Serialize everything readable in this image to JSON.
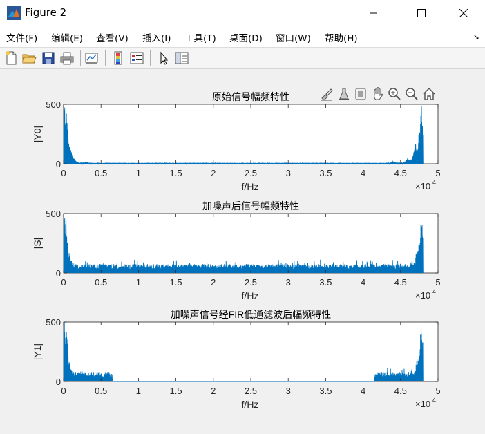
{
  "window": {
    "title": "Figure 2"
  },
  "menu": [
    {
      "label": "文件(F)"
    },
    {
      "label": "编辑(E)"
    },
    {
      "label": "查看(V)"
    },
    {
      "label": "插入(I)"
    },
    {
      "label": "工具(T)"
    },
    {
      "label": "桌面(D)"
    },
    {
      "label": "窗口(W)"
    },
    {
      "label": "帮助(H)"
    }
  ],
  "toolbar_icons": [
    "new-figure-icon",
    "open-file-icon",
    "save-icon",
    "print-icon",
    "link-plot-icon",
    "colorbar-icon",
    "legend-icon",
    "pointer-icon",
    "property-inspector-icon"
  ],
  "plot_toolbar_icons": [
    "brush-icon",
    "data-cursor-icon",
    "rotate-icon",
    "pan-icon",
    "zoom-in-icon",
    "zoom-out-icon",
    "home-icon"
  ],
  "colors": {
    "line": "#0072BD",
    "axes_bg": "#ffffff",
    "figure_bg": "#f0f0f0"
  },
  "chart_data": [
    {
      "type": "line",
      "title": "原始信号幅频特性",
      "xlabel": "f/Hz",
      "ylabel": "|Y0|",
      "xlim": [
        0,
        50000
      ],
      "ylim": [
        0,
        500
      ],
      "xticks": [
        "0",
        "0.5",
        "1",
        "1.5",
        "2",
        "2.5",
        "3",
        "3.5",
        "4",
        "4.5",
        "5"
      ],
      "yticks": [
        "0",
        "500"
      ],
      "x_exponent": "×10",
      "x_exponent_power": "4",
      "grid": false,
      "series": [
        {
          "noise_floor": 3,
          "spikes": [
            {
              "x": 100,
              "y": 500
            },
            {
              "x": 300,
              "y": 480
            },
            {
              "x": 600,
              "y": 180
            },
            {
              "x": 1000,
              "y": 60
            },
            {
              "x": 1500,
              "y": 30
            },
            {
              "x": 3000,
              "y": 18
            },
            {
              "x": 44000,
              "y": 25
            },
            {
              "x": 46000,
              "y": 50
            },
            {
              "x": 47000,
              "y": 160
            },
            {
              "x": 47800,
              "y": 500
            }
          ],
          "x_end": 48000
        }
      ]
    },
    {
      "type": "line",
      "title": "加噪声后信号幅频特性",
      "xlabel": "f/Hz",
      "ylabel": "|S|",
      "xlim": [
        0,
        50000
      ],
      "ylim": [
        0,
        500
      ],
      "xticks": [
        "0",
        "0.5",
        "1",
        "1.5",
        "2",
        "2.5",
        "3",
        "3.5",
        "4",
        "4.5",
        "5"
      ],
      "yticks": [
        "0",
        "500"
      ],
      "x_exponent": "×10",
      "x_exponent_power": "4",
      "grid": false,
      "series": [
        {
          "noise_floor": 60,
          "spikes": [
            {
              "x": 100,
              "y": 500
            },
            {
              "x": 300,
              "y": 470
            },
            {
              "x": 600,
              "y": 200
            },
            {
              "x": 1000,
              "y": 110
            },
            {
              "x": 46500,
              "y": 110
            },
            {
              "x": 47200,
              "y": 200
            },
            {
              "x": 47800,
              "y": 500
            }
          ],
          "x_end": 48000
        }
      ]
    },
    {
      "type": "line",
      "title": "加噪声信号经FIR低通滤波后幅频特性",
      "xlabel": "f/Hz",
      "ylabel": "|Y1|",
      "xlim": [
        0,
        50000
      ],
      "ylim": [
        0,
        500
      ],
      "xticks": [
        "0",
        "0.5",
        "1",
        "1.5",
        "2",
        "2.5",
        "3",
        "3.5",
        "4",
        "4.5",
        "5"
      ],
      "yticks": [
        "0",
        "500"
      ],
      "x_exponent": "×10",
      "x_exponent_power": "4",
      "grid": false,
      "series": [
        {
          "noise_floor": 60,
          "passband": [
            [
              0,
              6500
            ],
            [
              41500,
              48000
            ]
          ],
          "spikes": [
            {
              "x": 100,
              "y": 500
            },
            {
              "x": 300,
              "y": 470
            },
            {
              "x": 600,
              "y": 190
            },
            {
              "x": 1000,
              "y": 100
            },
            {
              "x": 46500,
              "y": 100
            },
            {
              "x": 47200,
              "y": 200
            },
            {
              "x": 47800,
              "y": 500
            }
          ],
          "x_end": 48000
        }
      ]
    }
  ]
}
